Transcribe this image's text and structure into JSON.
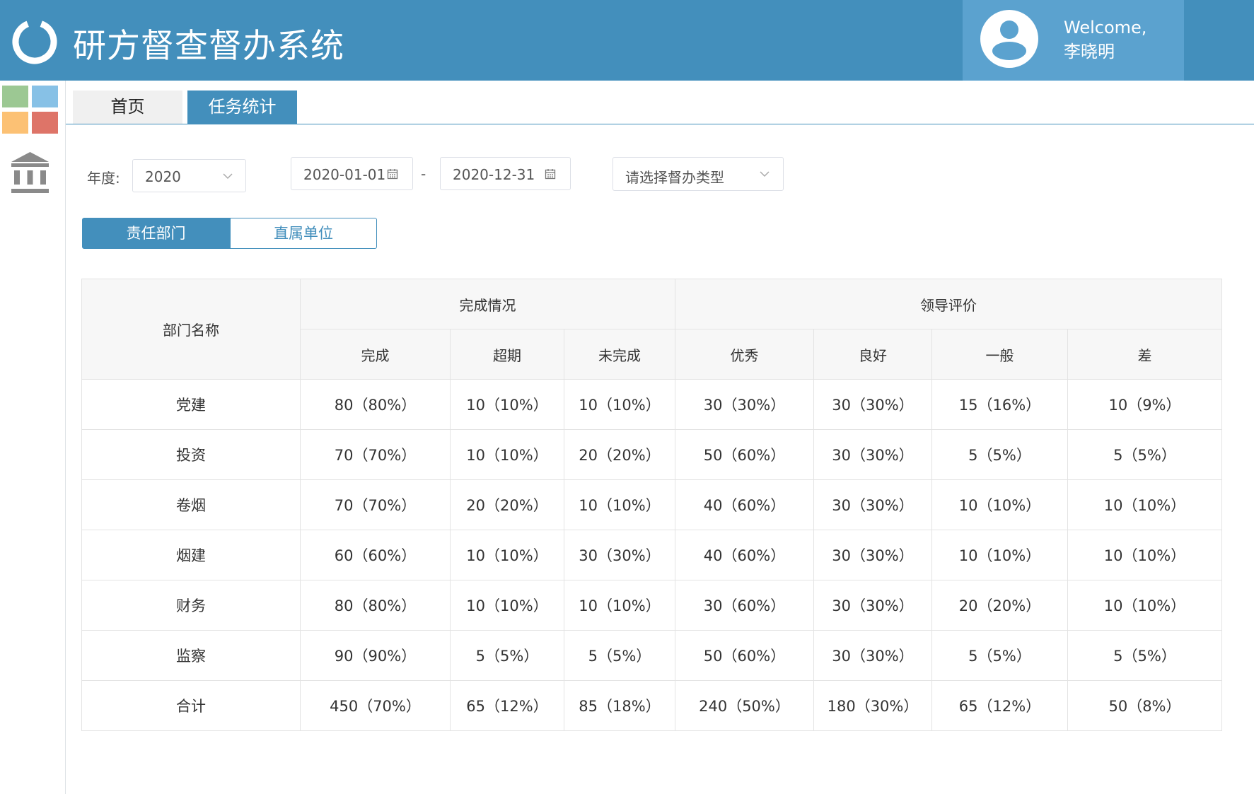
{
  "app": {
    "title": "研方督查督办系统",
    "welcome": "Welcome,",
    "user_name": "李晓明"
  },
  "icons": {
    "logo": "ring-logo-icon",
    "avatar": "user-avatar-icon",
    "grid": "app-grid-icon",
    "bank": "institution-icon",
    "calendar": "calendar-icon",
    "dropdown": "chevron-down-icon"
  },
  "colors": {
    "brand": "#438fbc",
    "user_box": "#5ba2cf",
    "tile_green": "#9cc893",
    "tile_blue": "#87c1e6",
    "tile_orange": "#fcc174",
    "tile_red": "#de7468"
  },
  "tabs": [
    {
      "label": "首页",
      "active": false
    },
    {
      "label": "任务统计",
      "active": true
    }
  ],
  "filters": {
    "year_label": "年度:",
    "year_value": "2020",
    "start_date": "2020-01-01",
    "date_separator": "-",
    "end_date": "2020-12-31",
    "type_placeholder": "请选择督办类型"
  },
  "segments": [
    {
      "label": "责任部门",
      "active": true
    },
    {
      "label": "直属单位",
      "active": false
    }
  ],
  "table": {
    "dept_header": "部门名称",
    "groups": [
      {
        "label": "完成情况",
        "span": 3
      },
      {
        "label": "领导评价",
        "span": 4
      }
    ],
    "subheaders": [
      "完成",
      "超期",
      "未完成",
      "优秀",
      "良好",
      "一般",
      "差"
    ],
    "rows": [
      {
        "name": "党建",
        "cells": [
          "80（80%）",
          "10（10%）",
          "10（10%）",
          "30（30%）",
          "30（30%）",
          "15（16%）",
          "10（9%）"
        ]
      },
      {
        "name": "投资",
        "cells": [
          "70（70%）",
          "10（10%）",
          "20（20%）",
          "50（60%）",
          "30（30%）",
          "5（5%）",
          "5（5%）"
        ]
      },
      {
        "name": "卷烟",
        "cells": [
          "70（70%）",
          "20（20%）",
          "10（10%）",
          "40（60%）",
          "30（30%）",
          "10（10%）",
          "10（10%）"
        ]
      },
      {
        "name": "烟建",
        "cells": [
          "60（60%）",
          "10（10%）",
          "30（30%）",
          "40（60%）",
          "30（30%）",
          "10（10%）",
          "10（10%）"
        ]
      },
      {
        "name": "财务",
        "cells": [
          "80（80%）",
          "10（10%）",
          "10（10%）",
          "30（60%）",
          "30（30%）",
          "20（20%）",
          "10（10%）"
        ]
      },
      {
        "name": "监察",
        "cells": [
          "90（90%）",
          "5（5%）",
          "5（5%）",
          "50（60%）",
          "30（30%）",
          "5（5%）",
          "5（5%）"
        ]
      },
      {
        "name": "合计",
        "cells": [
          "450（70%）",
          "65（12%）",
          "85（18%）",
          "240（50%）",
          "180（30%）",
          "65（12%）",
          "50（8%）"
        ]
      }
    ]
  }
}
